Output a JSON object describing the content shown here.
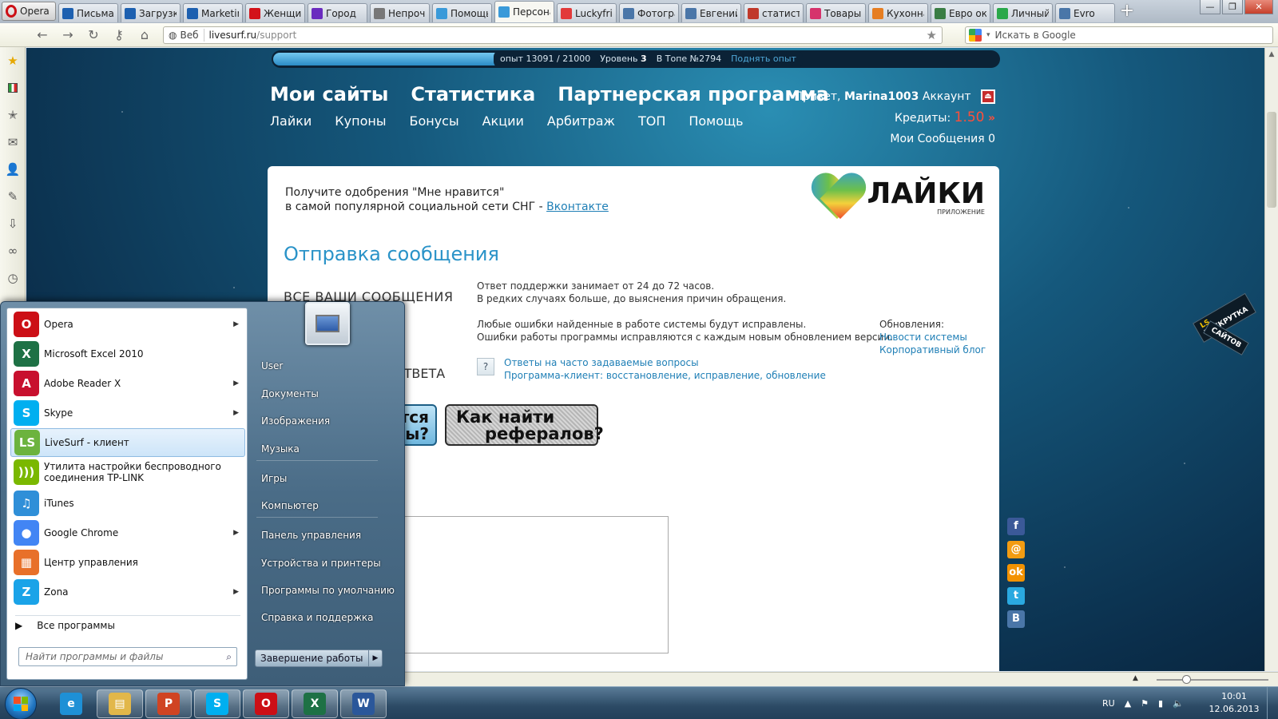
{
  "browser": {
    "menu_label": "Opera",
    "tabs": [
      {
        "label": "Письма",
        "icon": "mail-ru-icon",
        "color": "#1d60b0"
      },
      {
        "label": "Загрузки",
        "icon": "mail-ru-icon",
        "color": "#1d60b0"
      },
      {
        "label": "Marketing",
        "icon": "mail-ru-icon",
        "color": "#1d60b0"
      },
      {
        "label": "Женщина",
        "icon": "m-logo-icon",
        "color": "#d3121a"
      },
      {
        "label": "Город",
        "icon": "bookmarks-icon",
        "color": "#6a2bbf"
      },
      {
        "label": "Непрочитанные",
        "icon": "envelope-icon",
        "color": "#777777"
      },
      {
        "label": "Помощь",
        "icon": "livesurf-icon",
        "color": "#3a9ad9"
      },
      {
        "label": "Персональный",
        "icon": "livesurf-icon",
        "color": "#3a9ad9",
        "active": true
      },
      {
        "label": "Luckyfriends",
        "icon": "heart-icon",
        "color": "#e23a3a"
      },
      {
        "label": "Фотографии",
        "icon": "vk-icon",
        "color": "#4a76a8"
      },
      {
        "label": "Евгений",
        "icon": "vk-icon",
        "color": "#4a76a8"
      },
      {
        "label": "статистика",
        "icon": "chart-icon",
        "color": "#c0392b"
      },
      {
        "label": "Товары",
        "icon": "flower-icon",
        "color": "#d6336c"
      },
      {
        "label": "Кухонная",
        "icon": "arrow-icon",
        "color": "#e67e22"
      },
      {
        "label": "Евро окна",
        "icon": "house-icon",
        "color": "#3a7d44"
      },
      {
        "label": "Личный кабинет",
        "icon": "dots-icon",
        "color": "#2aa84a"
      },
      {
        "label": "Evro",
        "icon": "vk-icon",
        "color": "#4a76a8"
      }
    ],
    "address_mode": "Веб",
    "url_host": "livesurf.ru",
    "url_path": "/support",
    "search_placeholder": "Искать в Google"
  },
  "page": {
    "xp": {
      "text": "опыт 13091 / 21000",
      "level_label": "Уровень",
      "level": "3",
      "top_label": "В Топе №2794",
      "raise_label": "Поднять опыт",
      "progress": 0.623
    },
    "main_nav": [
      "Мои сайты",
      "Статистика",
      "Партнерская программа"
    ],
    "sub_nav": [
      "Лайки",
      "Купоны",
      "Бонусы",
      "Акции",
      "Арбитраж",
      "ТОП",
      "Помощь"
    ],
    "user": {
      "greeting": "Привет,",
      "username": "Marina1003",
      "account": "Аккаунт",
      "credits_label": "Кредиты:",
      "credits": "1.50",
      "messages": "Мои Сообщения 0"
    },
    "promo": {
      "line1": "Получите одобрения \"Мне нравится\"",
      "line2": "в самой популярной социальной сети СНГ -",
      "link": "Вконтакте"
    },
    "likes_logo": {
      "title": "ЛАЙКИ",
      "subtitle": "ПРИЛОЖЕНИЕ"
    },
    "send_title": "Отправка сообщения",
    "all_messages": "ВСЕ ВАШИ СООБЩЕНИЯ",
    "big_value": "%",
    "answer_label": "В ОТВЕТА",
    "info": {
      "p1a": "Ответ поддержки занимает от 24 до 72 часов.",
      "p1b": "В редких случаях больше, до выяснения причин обращения.",
      "p2a": "Любые ошибки найденные в работе системы будут исправлены.",
      "p2b": "Ошибки работы программы исправляются с каждым новым обновлением версии."
    },
    "faq": {
      "icon_label": "?",
      "link1": "Ответы на часто задаваемые вопросы",
      "link2": "Программа-клиент: восстановление, исправление, обновление"
    },
    "updates": {
      "label": "Обновления:",
      "link1": "Новости системы",
      "link2": "Корпоративный блог"
    },
    "btn_blue": {
      "line1": "ются",
      "line2": "азы?"
    },
    "btn_dark": {
      "line1": "Как найти",
      "line2": "рефералов?"
    },
    "raskrutka": {
      "ls": "LS",
      "line1": "РАСКРУТКА",
      "line2": "САЙТОВ"
    },
    "social": [
      {
        "label": "f",
        "icon": "facebook-icon",
        "color": "#3b5998"
      },
      {
        "label": "@",
        "icon": "mail-ru-icon",
        "color": "#f39c12"
      },
      {
        "label": "ok",
        "icon": "odnoklassniki-icon",
        "color": "#f39200"
      },
      {
        "label": "t",
        "icon": "twitter-icon",
        "color": "#2aa9e0"
      },
      {
        "label": "B",
        "icon": "vk-icon",
        "color": "#4a76a8"
      }
    ]
  },
  "start_menu": {
    "programs": [
      {
        "label": "Opera",
        "icon": "opera-icon",
        "color": "#cc0f16",
        "glyph": "O",
        "arrow": true
      },
      {
        "label": "Microsoft Excel 2010",
        "icon": "excel-icon",
        "color": "#1e7145",
        "glyph": "X",
        "arrow": false
      },
      {
        "label": "Adobe Reader X",
        "icon": "adobe-reader-icon",
        "color": "#c8102e",
        "glyph": "A",
        "arrow": true
      },
      {
        "label": "Skype",
        "icon": "skype-icon",
        "color": "#00aff0",
        "glyph": "S",
        "arrow": true
      },
      {
        "label": "LiveSurf - клиент",
        "icon": "livesurf-icon",
        "color": "#6cb33e",
        "glyph": "LS",
        "arrow": false,
        "selected": true
      },
      {
        "label": "Утилита настройки беспроводного соединения TP-LINK",
        "icon": "wifi-icon",
        "color": "#7ab800",
        "glyph": ")))",
        "arrow": false
      },
      {
        "label": "iTunes",
        "icon": "itunes-icon",
        "color": "#2f8fd8",
        "glyph": "♫",
        "arrow": false
      },
      {
        "label": "Google Chrome",
        "icon": "chrome-icon",
        "color": "#4285f4",
        "glyph": "●",
        "arrow": true
      },
      {
        "label": "Центр управления",
        "icon": "control-center-icon",
        "color": "#e8702a",
        "glyph": "▦",
        "arrow": false
      },
      {
        "label": "Zona",
        "icon": "zona-icon",
        "color": "#1aa3e8",
        "glyph": "Z",
        "arrow": true
      }
    ],
    "all_programs": "Все программы",
    "search_placeholder": "Найти программы и файлы",
    "right": [
      "User",
      "Документы",
      "Изображения",
      "Музыка",
      "Игры",
      "Компьютер",
      "Панель управления",
      "Устройства и принтеры",
      "Программы по умолчанию",
      "Справка и поддержка"
    ],
    "shutdown": "Завершение работы"
  },
  "taskbar": {
    "apps": [
      {
        "icon": "ie-icon",
        "color": "#1e90d6",
        "glyph": "e",
        "open": false
      },
      {
        "icon": "explorer-icon",
        "color": "#e2b74a",
        "glyph": "▤",
        "open": true
      },
      {
        "icon": "powerpoint-icon",
        "color": "#d04423",
        "glyph": "P",
        "open": true
      },
      {
        "icon": "skype-icon",
        "color": "#00aff0",
        "glyph": "S",
        "open": true
      },
      {
        "icon": "opera-icon",
        "color": "#cc0f16",
        "glyph": "O",
        "open": true
      },
      {
        "icon": "excel-icon",
        "color": "#1e7145",
        "glyph": "X",
        "open": true
      },
      {
        "icon": "word-icon",
        "color": "#2b579a",
        "glyph": "W",
        "open": true
      }
    ],
    "lang": "RU",
    "time": "10:01",
    "date": "12.06.2013"
  }
}
